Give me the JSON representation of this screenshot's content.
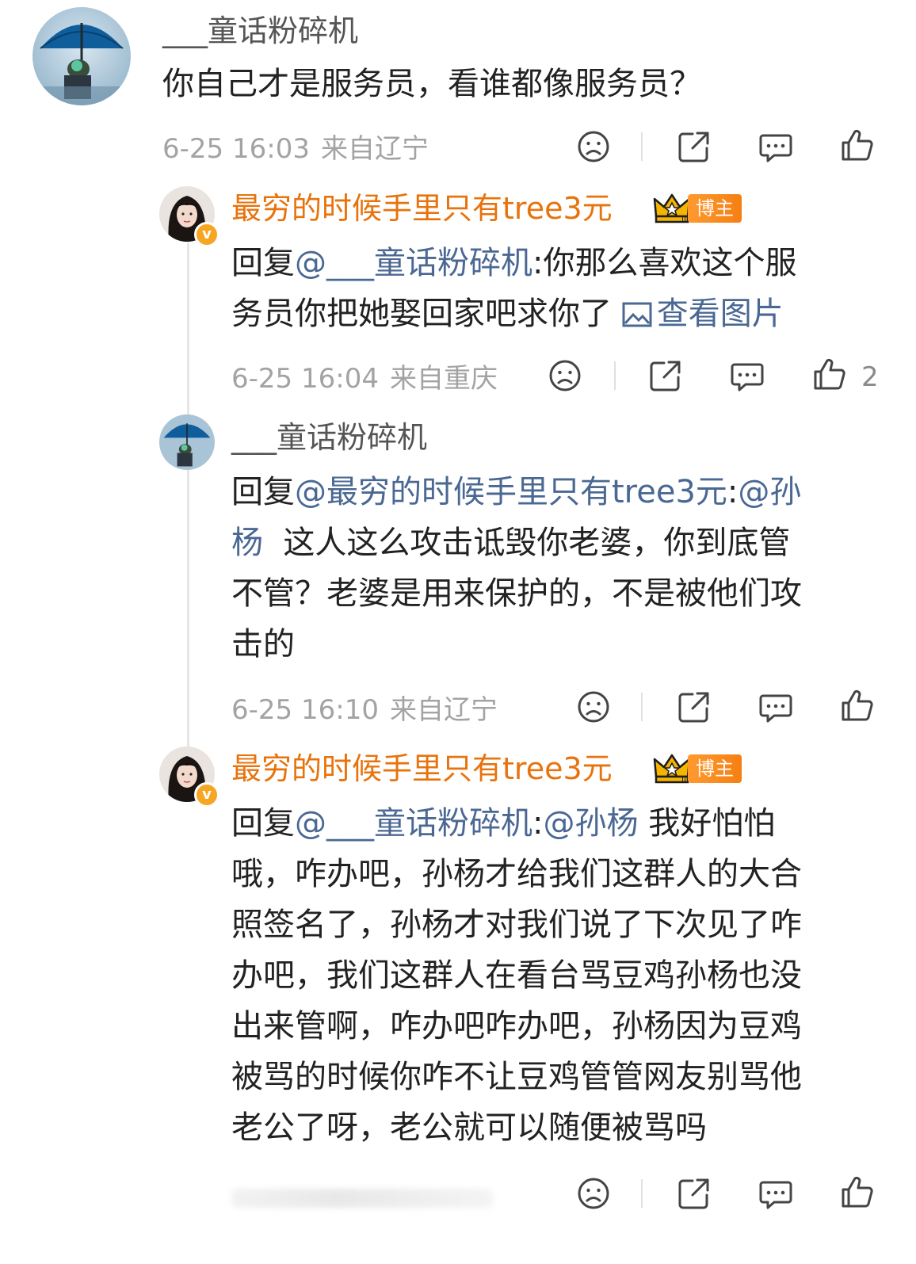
{
  "comment_main": {
    "username": "___童话粉碎机",
    "text": "你自己才是服务员，看谁都像服务员？",
    "time": "6-25 16:03",
    "location": "来自辽宁"
  },
  "replies": [
    {
      "username": "最穷的时候手里只有tree3元",
      "badge": "博主",
      "reply_prefix": "回复",
      "mention": "@___童话粉碎机",
      "text_line1": ":你那么喜欢这个服",
      "text_line2": "务员你把她娶回家吧求你了",
      "view_image": "查看图片",
      "time": "6-25 16:04",
      "location": "来自重庆",
      "like_count": "2"
    },
    {
      "username": "___童话粉碎机",
      "reply_prefix": "回复",
      "mention": "@最穷的时候手里只有tree3元",
      "colon": ":",
      "mention2_a": "@孙",
      "mention2_b": "杨",
      "text_line2": "  这人这么攻击诋毁你老婆，你到底管",
      "text_line3": "不管？老婆是用来保护的，不是被他们攻",
      "text_line4": "击的",
      "time": "6-25 16:10",
      "location": "来自辽宁"
    },
    {
      "username": "最穷的时候手里只有tree3元",
      "badge": "博主",
      "reply_prefix": "回复",
      "mention": "@___童话粉碎机",
      "colon": ":",
      "mention2": "@孙杨",
      "text_line1": " 我好怕怕",
      "text_line2": "哦，咋办吧，孙杨才给我们这群人的大合",
      "text_line3": "照签名了，孙杨才对我们说了下次见了咋",
      "text_line4": "办吧，我们这群人在看台骂豆鸡孙杨也没",
      "text_line5": "出来管啊，咋办吧咋办吧，孙杨因为豆鸡",
      "text_line6": "被骂的时候你咋不让豆鸡管管网友别骂他",
      "text_line7": "老公了呀，老公就可以随便被骂吗"
    }
  ],
  "icons": {
    "dislike": "sad-face-icon",
    "share": "share-icon",
    "comment": "comment-icon",
    "like": "thumbs-up-icon"
  },
  "colors": {
    "author": "#e8730c",
    "mention": "#4a6893",
    "meta": "#a3a3a3"
  }
}
